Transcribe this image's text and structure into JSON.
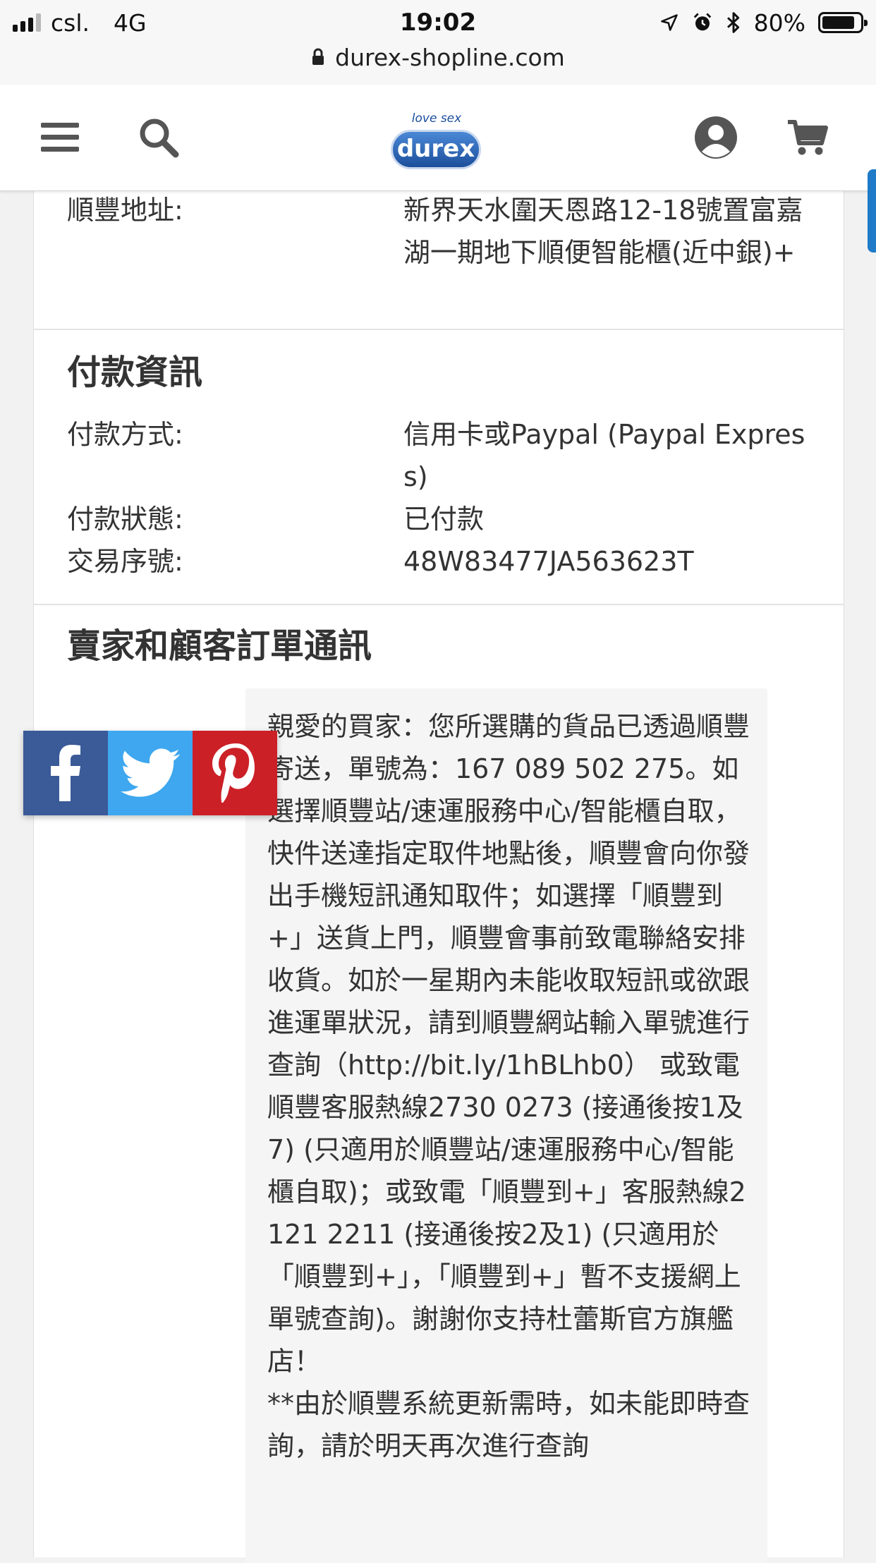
{
  "status_bar": {
    "carrier": "csl.",
    "network": "4G",
    "time": "19:02",
    "battery": "80%",
    "url": "durex-shopline.com",
    "icons": [
      "location-arrow-icon",
      "alarm-icon",
      "bluetooth-icon",
      "battery-icon",
      "lock-icon"
    ]
  },
  "header": {
    "logo_tagline": "love sex",
    "logo_name": "durex",
    "icons": [
      "hamburger-menu-icon",
      "search-icon",
      "account-icon",
      "cart-icon"
    ],
    "accent": "#1c4f9c"
  },
  "shipping": {
    "address_label": "順豐地址:",
    "address_value": "新界天水圍天恩路12-18號置富嘉湖一期地下順便智能櫃(近中銀)+"
  },
  "payment": {
    "title": "付款資訊",
    "method_label": "付款方式:",
    "method_value": "信用卡或Paypal (Paypal Express)",
    "status_label": "付款狀態:",
    "status_value": "已付款",
    "txn_label": "交易序號:",
    "txn_value": "48W83477JA563623T"
  },
  "messages": {
    "title": "賣家和顧客訂單通訊",
    "body": "親愛的買家：您所選購的貨品已透過順豐寄送，單號為：167 089 502 275。如選擇順豐站/速運服務中心/智能櫃自取，快件送達指定取件地點後，順豐會向你發出手機短訊通知取件；如選擇「順豐到+」送貨上門，順豐會事前致電聯絡安排收貨。如於一星期內未能收取短訊或欲跟進運單狀況，請到順豐網站輸入單號進行查詢（http://bit.ly/1hBLhb0） 或致電順豐客服熱線2730 0273 (接通後按1及7) (只適用於順豐站/速運服務中心/智能櫃自取)；或致電「順豐到+」客服熱線2121 2211 (接通後按2及1) (只適用於「順豐到+」，「順豐到+」暫不支援網上單號查詢)。謝謝你支持杜蕾斯官方旗艦店！\n**由於順豐系統更新需時，如未能即時查詢，請於明天再次進行查詢"
  },
  "share": {
    "buttons": [
      {
        "name": "facebook",
        "icon": "facebook-icon",
        "color": "#3a5a98"
      },
      {
        "name": "twitter",
        "icon": "twitter-icon",
        "color": "#3ea7ef"
      },
      {
        "name": "pinterest",
        "icon": "pinterest-icon",
        "color": "#cc2027"
      }
    ]
  }
}
